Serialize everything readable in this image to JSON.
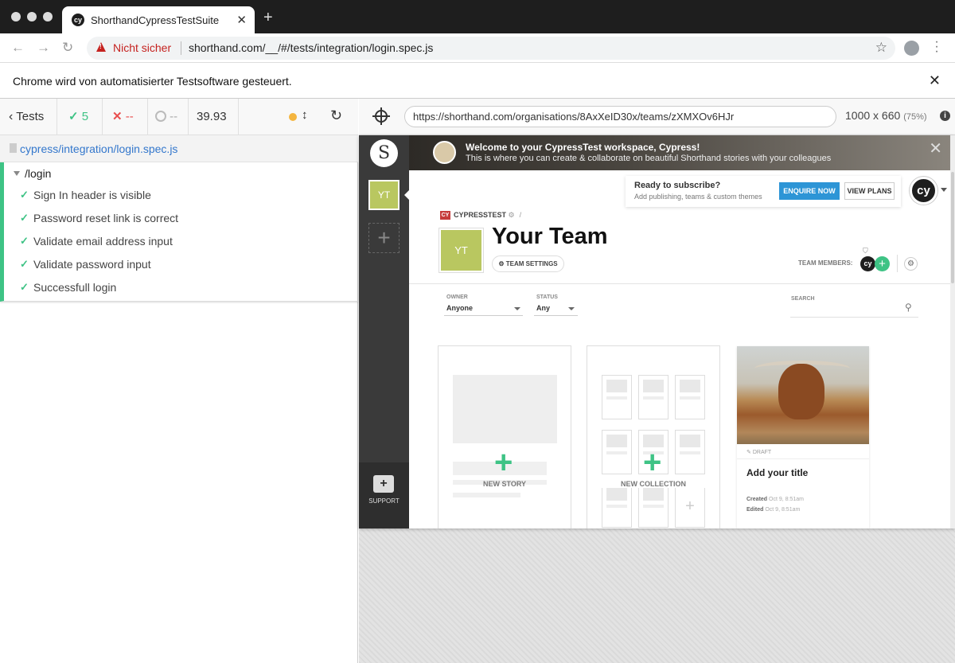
{
  "browser": {
    "tab_title": "ShorthandCypressTestSuite",
    "tab_icon": "cy",
    "security_label": "Nicht sicher",
    "url": "shorthand.com/__/#/tests/integration/login.spec.js",
    "automation_notice": "Chrome wird von automatisierter Testsoftware gesteuert."
  },
  "reporter": {
    "tests_label": "Tests",
    "passed": "5",
    "failed": "--",
    "pending": "--",
    "duration": "39.93",
    "spec_path": "cypress/integration/login.spec.js",
    "suite_name": "/login",
    "tests": [
      {
        "title": "Sign In header is visible",
        "state": "passed"
      },
      {
        "title": "Password reset link is correct",
        "state": "passed"
      },
      {
        "title": "Validate email address input",
        "state": "passed"
      },
      {
        "title": "Validate password input",
        "state": "passed"
      },
      {
        "title": "Successfull login",
        "state": "passed"
      }
    ],
    "colors": {
      "passed": "#3ec385",
      "failed": "#e94f4f",
      "running": "#f4b53f",
      "link": "#3377cc"
    }
  },
  "aut": {
    "url": "https://shorthand.com/organisations/8AxXeID30x/teams/zXMXOv6HJr",
    "viewport": "1000 x 660",
    "scale": "(75%)"
  },
  "shorthand": {
    "logo": "S",
    "team_initials": "YT",
    "support_label": "SUPPORT",
    "banner_title": "Welcome to your CypressTest workspace, Cypress!",
    "banner_subtitle": "This is where you can create & collaborate on beautiful Shorthand stories with your colleagues",
    "subscribe_title": "Ready to subscribe?",
    "subscribe_subtitle": "Add publishing, teams & custom themes",
    "enquire_label": "ENQUIRE NOW",
    "plans_label": "VIEW PLANS",
    "user_initials": "cy",
    "org_badge": "CY",
    "org_name": "CYPRESSTEST",
    "team_title": "Your Team",
    "team_settings_label": "TEAM SETTINGS",
    "team_members_label": "TEAM MEMBERS:",
    "filters": {
      "owner_label": "OWNER",
      "owner_value": "Anyone",
      "status_label": "STATUS",
      "status_value": "Any",
      "search_label": "SEARCH"
    },
    "new_story_label": "NEW STORY",
    "new_collection_label": "NEW COLLECTION",
    "story": {
      "status": "DRAFT",
      "title": "Add your title",
      "created_label": "Created",
      "created_value": "Oct 9, 8:51am",
      "edited_label": "Edited",
      "edited_value": "Oct 9, 8:51am"
    },
    "colors": {
      "accent": "#3ec385",
      "team_tile": "#b9c760",
      "enquire": "#2d95d6"
    }
  }
}
